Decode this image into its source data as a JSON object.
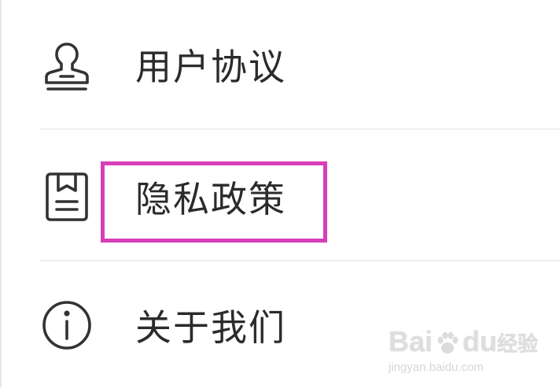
{
  "menu": {
    "items": [
      {
        "label": "用户协议",
        "icon": "user-stamp-icon"
      },
      {
        "label": "隐私政策",
        "icon": "document-icon",
        "highlighted": true
      },
      {
        "label": "关于我们",
        "icon": "info-icon"
      }
    ]
  },
  "highlight": {
    "color": "#d63fb8"
  },
  "watermark": {
    "logo_text": "Bai",
    "logo_suffix": "du",
    "logo_cn": "经验",
    "url": "jingyan.baidu.com"
  }
}
